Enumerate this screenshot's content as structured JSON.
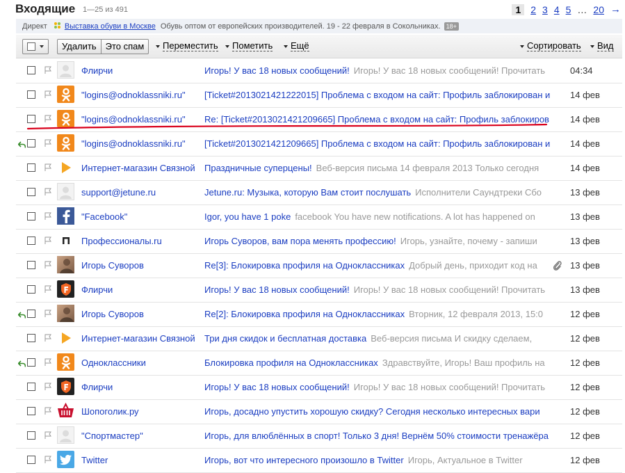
{
  "header": {
    "title": "Входящие",
    "count": "1—25 из 491",
    "pages": [
      "1",
      "2",
      "3",
      "4",
      "5",
      "…",
      "20"
    ],
    "next_arrow": "→"
  },
  "direct": {
    "label": "Директ",
    "link": "Выставка обуви в Москве",
    "text": "Обувь оптом от европейских производителей. 19 - 22 февраля в Сокольниках.",
    "age": "18+"
  },
  "toolbar": {
    "delete_label": "Удалить",
    "spam_label": "Это спам",
    "move_label": "Переместить",
    "mark_label": "Пометить",
    "more_label": "Ещё",
    "sort_label": "Сортировать",
    "view_label": "Вид"
  },
  "colors": {
    "link": "#1a3dc1",
    "preview": "#999999",
    "underline_mark": "#d9001b",
    "odnoklassniki": "#f1881b"
  },
  "messages": [
    {
      "from": "Флирчи",
      "subject": "Игорь! У вас 18 новых сообщений!",
      "preview": "Игорь! У вас 18 новых сообщений! Прочитать",
      "date": "04:34",
      "avatar": "grey-icon",
      "replied": false,
      "attachment": false
    },
    {
      "from": "\"logins@odnoklassniki.ru\"",
      "subject": "[Ticket#2013021421222015] Проблема с входом на сайт: Профиль заблокирован и",
      "preview": "",
      "date": "14 фев",
      "avatar": "odnoklassniki-icon",
      "replied": false,
      "attachment": false
    },
    {
      "from": "\"logins@odnoklassniki.ru\"",
      "subject": "Re: [Ticket#2013021421209665] Проблема с входом на сайт: Профиль заблокиров",
      "preview": "",
      "date": "14 фев",
      "avatar": "odnoklassniki-icon",
      "replied": false,
      "attachment": false
    },
    {
      "from": "\"logins@odnoklassniki.ru\"",
      "subject": "[Ticket#2013021421209665] Проблема с входом на сайт: Профиль заблокирован и",
      "preview": "",
      "date": "14 фев",
      "avatar": "odnoklassniki-icon",
      "replied": true,
      "attachment": false
    },
    {
      "from": "Интернет-магазин Связной",
      "subject": "Праздничные суперцены!",
      "preview": "Веб-версия письма 14 февраля 2013 Только сегодня",
      "date": "14 фев",
      "avatar": "svyaznoy-icon",
      "replied": false,
      "attachment": false
    },
    {
      "from": "support@jetune.ru",
      "subject": "Jetune.ru: Музыка, которую Вам стоит послушать",
      "preview": "Исполнители Саундтреки Сбо",
      "date": "13 фев",
      "avatar": "grey-icon",
      "replied": false,
      "attachment": false
    },
    {
      "from": "\"Facebook\"",
      "subject": "Igor, you have 1 poke",
      "preview": "facebook You have new notifications. A lot has happened on",
      "date": "13 фев",
      "avatar": "facebook-icon",
      "replied": false,
      "attachment": false
    },
    {
      "from": "Профессионалы.ru",
      "subject": "Игорь Суворов, вам пора менять профессию!",
      "preview": "Игорь, узнайте, почему - запиши",
      "date": "13 фев",
      "avatar": "professionals-icon",
      "replied": false,
      "attachment": false
    },
    {
      "from": "Игорь Суворов",
      "subject": "Re[3]: Блокировка профиля на Одноклассниках",
      "preview": "Добрый день, приходит код на",
      "date": "13 фев",
      "avatar": "photo-icon",
      "replied": false,
      "attachment": true
    },
    {
      "from": "Флирчи",
      "subject": "Игорь! У вас 18 новых сообщений!",
      "preview": "Игорь! У вас 18 новых сообщений! Прочитать",
      "date": "13 фев",
      "avatar": "flirchi-icon",
      "replied": false,
      "attachment": false
    },
    {
      "from": "Игорь Суворов",
      "subject": "Re[2]: Блокировка профиля на Одноклассниках",
      "preview": "Вторник, 12 февраля 2013, 15:0",
      "date": "12 фев",
      "avatar": "photo-icon",
      "replied": true,
      "attachment": false
    },
    {
      "from": "Интернет-магазин Связной",
      "subject": "Три дня скидок и бесплатная доставка",
      "preview": "Веб-версия письма И скидку сделаем,",
      "date": "12 фев",
      "avatar": "svyaznoy-icon",
      "replied": false,
      "attachment": false
    },
    {
      "from": "Одноклассники",
      "subject": "Блокировка профиля на Одноклассниках",
      "preview": "Здравствуйте, Игорь! Ваш профиль на",
      "date": "12 фев",
      "avatar": "odnoklassniki-icon",
      "replied": true,
      "attachment": false
    },
    {
      "from": "Флирчи",
      "subject": "Игорь! У вас 18 новых сообщений!",
      "preview": "Игорь! У вас 18 новых сообщений! Прочитать",
      "date": "12 фев",
      "avatar": "flirchi-icon",
      "replied": false,
      "attachment": false
    },
    {
      "from": "Шопоголик.ру",
      "subject": "Игорь, досадно упустить хорошую скидку? Сегодня несколько интересных вари",
      "preview": "",
      "date": "12 фев",
      "avatar": "shop-basket-icon",
      "replied": false,
      "attachment": false
    },
    {
      "from": "\"Спортмастер\"",
      "subject": "Игорь, для влюблённых в спорт! Только 3 дня! Вернём 50% стоимости тренажёра",
      "preview": "",
      "date": "12 фев",
      "avatar": "grey-icon",
      "replied": false,
      "attachment": false
    },
    {
      "from": "Twitter",
      "subject": "Игорь, вот что интересного произошло в Twitter",
      "preview": "Игорь, Актуальное в Twitter",
      "date": "12 фев",
      "avatar": "twitter-icon",
      "replied": false,
      "attachment": false
    }
  ]
}
